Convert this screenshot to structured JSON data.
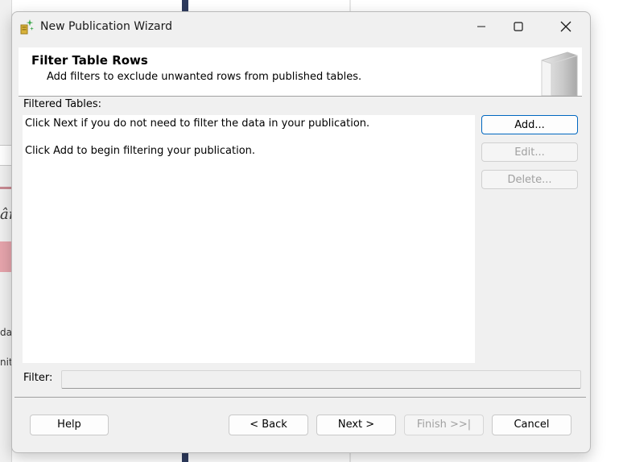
{
  "dialog": {
    "title": "New Publication Wizard",
    "window_controls": [
      "minimize-icon",
      "maximize-icon",
      "close-icon"
    ]
  },
  "header": {
    "title": "Filter Table Rows",
    "subtitle": "Add filters to exclude unwanted rows from published tables."
  },
  "filtered_tables": {
    "label": "Filtered Tables:",
    "lines": [
      "Click Next if you do not need to filter the data in your publication.",
      "Click Add to begin filtering your publication."
    ]
  },
  "side_buttons": {
    "add": "Add...",
    "edit": "Edit...",
    "delete": "Delete..."
  },
  "filter": {
    "label": "Filter:",
    "value": ""
  },
  "footer": {
    "help": "Help",
    "back": "< Back",
    "next": "Next >",
    "finish": "Finish >>|",
    "cancel": "Cancel"
  },
  "background": {
    "fragments": [
      "ân",
      "dat",
      "nitia"
    ]
  },
  "colors": {
    "accent": "#0067c0",
    "dialog_bg": "#f0f0f0",
    "disabled_text": "#a0a0a0"
  }
}
